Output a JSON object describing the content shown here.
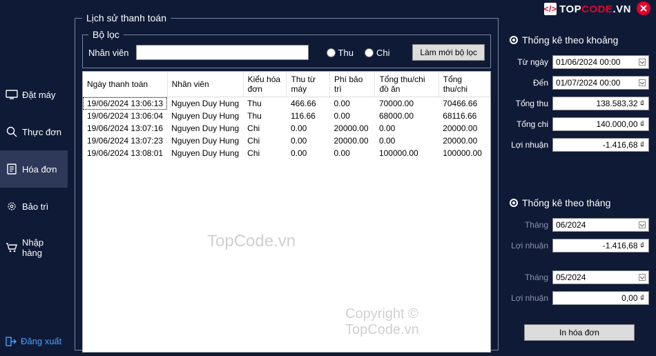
{
  "brand": {
    "logo_glyph": "</>",
    "name_part1": "TOP",
    "name_part2": "CODE",
    "name_suffix": ".VN"
  },
  "sidebar": {
    "items": [
      {
        "label": "Đặt máy"
      },
      {
        "label": "Thực đơn"
      },
      {
        "label": "Hóa đơn"
      },
      {
        "label": "Bảo trì"
      },
      {
        "label": "Nhập hàng"
      }
    ],
    "logout": "Đăng xuất"
  },
  "history": {
    "legend": "Lịch sử thanh toán",
    "filter": {
      "legend": "Bộ lọc",
      "employee_label": "Nhân viên",
      "employee_value": "",
      "radio_thu": "Thu",
      "radio_chi": "Chi",
      "reset_btn": "Làm mới bộ lọc"
    },
    "columns": [
      "Ngày thanh toán",
      "Nhân viên",
      "Kiểu hóa đơn",
      "Thu từ máy",
      "Phí bảo trì",
      "Tổng thu/chi đồ ăn",
      "Tổng thu/chi"
    ],
    "rows": [
      {
        "c": [
          "19/06/2024 13:06:13",
          "Nguyen Duy Hung",
          "Thu",
          "466.66",
          "0.00",
          "70000.00",
          "70466.66"
        ]
      },
      {
        "c": [
          "19/06/2024 13:06:04",
          "Nguyen Duy Hung",
          "Thu",
          "116.66",
          "0.00",
          "68000.00",
          "68116.66"
        ]
      },
      {
        "c": [
          "19/06/2024 13:07:16",
          "Nguyen Duy Hung",
          "Chi",
          "0.00",
          "20000.00",
          "0.00",
          "20000.00"
        ]
      },
      {
        "c": [
          "19/06/2024 13:07:23",
          "Nguyen Duy Hung",
          "Chi",
          "0.00",
          "20000.00",
          "0.00",
          "20000.00"
        ]
      },
      {
        "c": [
          "19/06/2024 13:08:01",
          "Nguyen Duy Hung",
          "Chi",
          "0.00",
          "0.00",
          "100000.00",
          "100000.00"
        ]
      }
    ]
  },
  "stats_range": {
    "title": "Thống kê theo khoảng",
    "from_label": "Từ ngày",
    "from_value": "01/06/2024 00:00",
    "to_label": "Đến",
    "to_value": "01/07/2024 00:00",
    "rev_label": "Tổng thu",
    "rev_value": "138.583,32 ₫",
    "exp_label": "Tổng chi",
    "exp_value": "140.000,00 ₫",
    "profit_label": "Lợi nhuận",
    "profit_value": "-1.416,68 ₫"
  },
  "stats_month": {
    "title": "Thống kê theo tháng",
    "m1_label": "Tháng",
    "m1_value": "06/2024",
    "p1_label": "Lợi nhuận",
    "p1_value": "-1.416,68 ₫",
    "m2_label": "Tháng",
    "m2_value": "05/2024",
    "p2_label": "Lợi nhuận",
    "p2_value": "0,00 ₫"
  },
  "print_btn": "In hóa đơn",
  "watermark1": "TopCode.vn",
  "watermark2": "Copyright © TopCode.vn"
}
